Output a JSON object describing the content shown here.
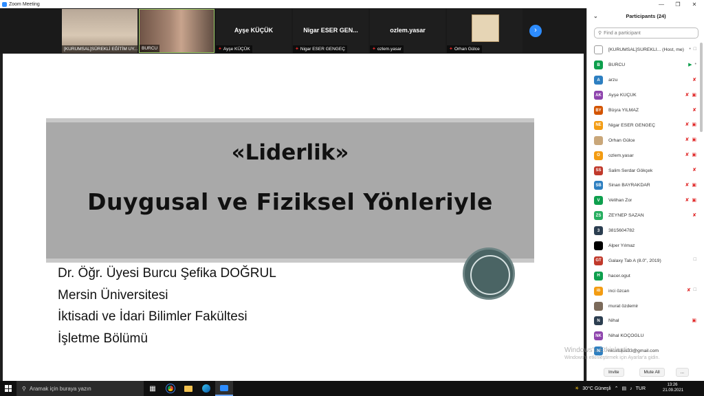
{
  "window": {
    "title": "Zoom Meeting",
    "minimize_icon": "minimize-icon",
    "maximize_icon": "maximize-icon",
    "close_icon": "close-icon"
  },
  "video_strip": {
    "tiles": [
      {
        "name": "[KURUMSAL]SÜREKLİ EĞİTİM UY...",
        "kind": "video",
        "bg": "#c9b8a6"
      },
      {
        "name": "BURCU",
        "kind": "video",
        "bg": "#8d6e5c"
      },
      {
        "name": "Ayşe KÜÇÜK",
        "label": "Ayşe KÜÇÜK",
        "kind": "text",
        "muted": true
      },
      {
        "name": "Nigar ESER GENGEÇ",
        "label": "Nigar ESER GEN...",
        "kind": "text",
        "muted": true
      },
      {
        "name": "ozlem.yasar",
        "label": "ozlem.yasar",
        "kind": "text",
        "muted": true
      },
      {
        "name": "Orhan Gülce",
        "kind": "image",
        "muted": true,
        "bg": "#d9c4a1"
      }
    ]
  },
  "slide": {
    "title": "«Liderlik»",
    "subtitle": "Duygusal ve Fiziksel Yönleriyle",
    "lines": [
      "Dr. Öğr. Üyesi Burcu Şefika DOĞRUL",
      "Mersin Üniversitesi",
      "İktisadi ve İdari Bilimler Fakültesi",
      "İşletme Bölümü"
    ]
  },
  "participants": {
    "title": "Participants (24)",
    "search_placeholder": "Find a participant",
    "items": [
      {
        "name": "[KURUMSAL]SÜREKLİ...  (Host, me)",
        "initials": "",
        "color": "#ffffff",
        "mic": "on",
        "cam": "on"
      },
      {
        "name": "BURCU",
        "initials": "B",
        "color": "#0e9f4d",
        "mic": "on",
        "cam": "live"
      },
      {
        "name": "arzu",
        "initials": "A",
        "color": "#2d7fc1",
        "mic": "off",
        "cam": "none"
      },
      {
        "name": "Ayşe KÜÇÜK",
        "initials": "AK",
        "color": "#8e44ad",
        "mic": "off",
        "cam": "off"
      },
      {
        "name": "Büşra YILMAZ",
        "initials": "BY",
        "color": "#d35400",
        "mic": "off",
        "cam": "none"
      },
      {
        "name": "Nigar ESER GENGEÇ",
        "initials": "NE",
        "color": "#f39c12",
        "mic": "off",
        "cam": "off"
      },
      {
        "name": "Orhan Gülce",
        "initials": "",
        "color": "#c9a77a",
        "mic": "off",
        "cam": "off"
      },
      {
        "name": "ozlem.yasar",
        "initials": "O",
        "color": "#f39c12",
        "mic": "off",
        "cam": "off"
      },
      {
        "name": "Salim Serdar Gökçek",
        "initials": "SS",
        "color": "#c0392b",
        "mic": "off",
        "cam": "none"
      },
      {
        "name": "Sinan BAYRAKDAR",
        "initials": "SB",
        "color": "#2d7fc1",
        "mic": "off",
        "cam": "off"
      },
      {
        "name": "Velihan Zor",
        "initials": "V",
        "color": "#0e9f4d",
        "mic": "off",
        "cam": "off"
      },
      {
        "name": "ZEYNEP SAZAN",
        "initials": "ZS",
        "color": "#27ae60",
        "mic": "off",
        "cam": "none"
      },
      {
        "name": "3815604782",
        "initials": "3",
        "color": "#2c3e50",
        "mic": "none",
        "cam": "none"
      },
      {
        "name": "Alper Yılmaz",
        "initials": "",
        "color": "#000000",
        "mic": "none",
        "cam": "none"
      },
      {
        "name": "Galaxy Tab A (8.0\", 2019)",
        "initials": "GT",
        "color": "#c0392b",
        "mic": "none",
        "cam": "on"
      },
      {
        "name": "hacer.ogut",
        "initials": "H",
        "color": "#0e9f4d",
        "mic": "none",
        "cam": "none"
      },
      {
        "name": "inci özcan",
        "initials": "iö",
        "color": "#f39c12",
        "mic": "off",
        "cam": "on"
      },
      {
        "name": "murat özdemir",
        "initials": "",
        "color": "#7b6a5a",
        "mic": "none",
        "cam": "none"
      },
      {
        "name": "Nihal",
        "initials": "N",
        "color": "#2c3e50",
        "mic": "none",
        "cam": "off"
      },
      {
        "name": "Nihal KOÇOĞLU",
        "initials": "NK",
        "color": "#8e44ad",
        "mic": "none",
        "cam": "none"
      },
      {
        "name": "nkurtulus33@gmail.com",
        "initials": "N",
        "color": "#2d7fc1",
        "mic": "none",
        "cam": "none"
      }
    ],
    "invite_label": "Invite",
    "mute_all_label": "Mute All",
    "more_label": "..."
  },
  "watermark": {
    "line1": "Windows'u Etkinleştir",
    "line2": "Windows'u etkinleştirmek için Ayarlar'a gidin."
  },
  "taskbar": {
    "search_placeholder": "Aramak için buraya yazın",
    "weather": "30°C  Güneşli",
    "lang": "TUR",
    "time": "13:26",
    "date": "21.09.2021"
  }
}
